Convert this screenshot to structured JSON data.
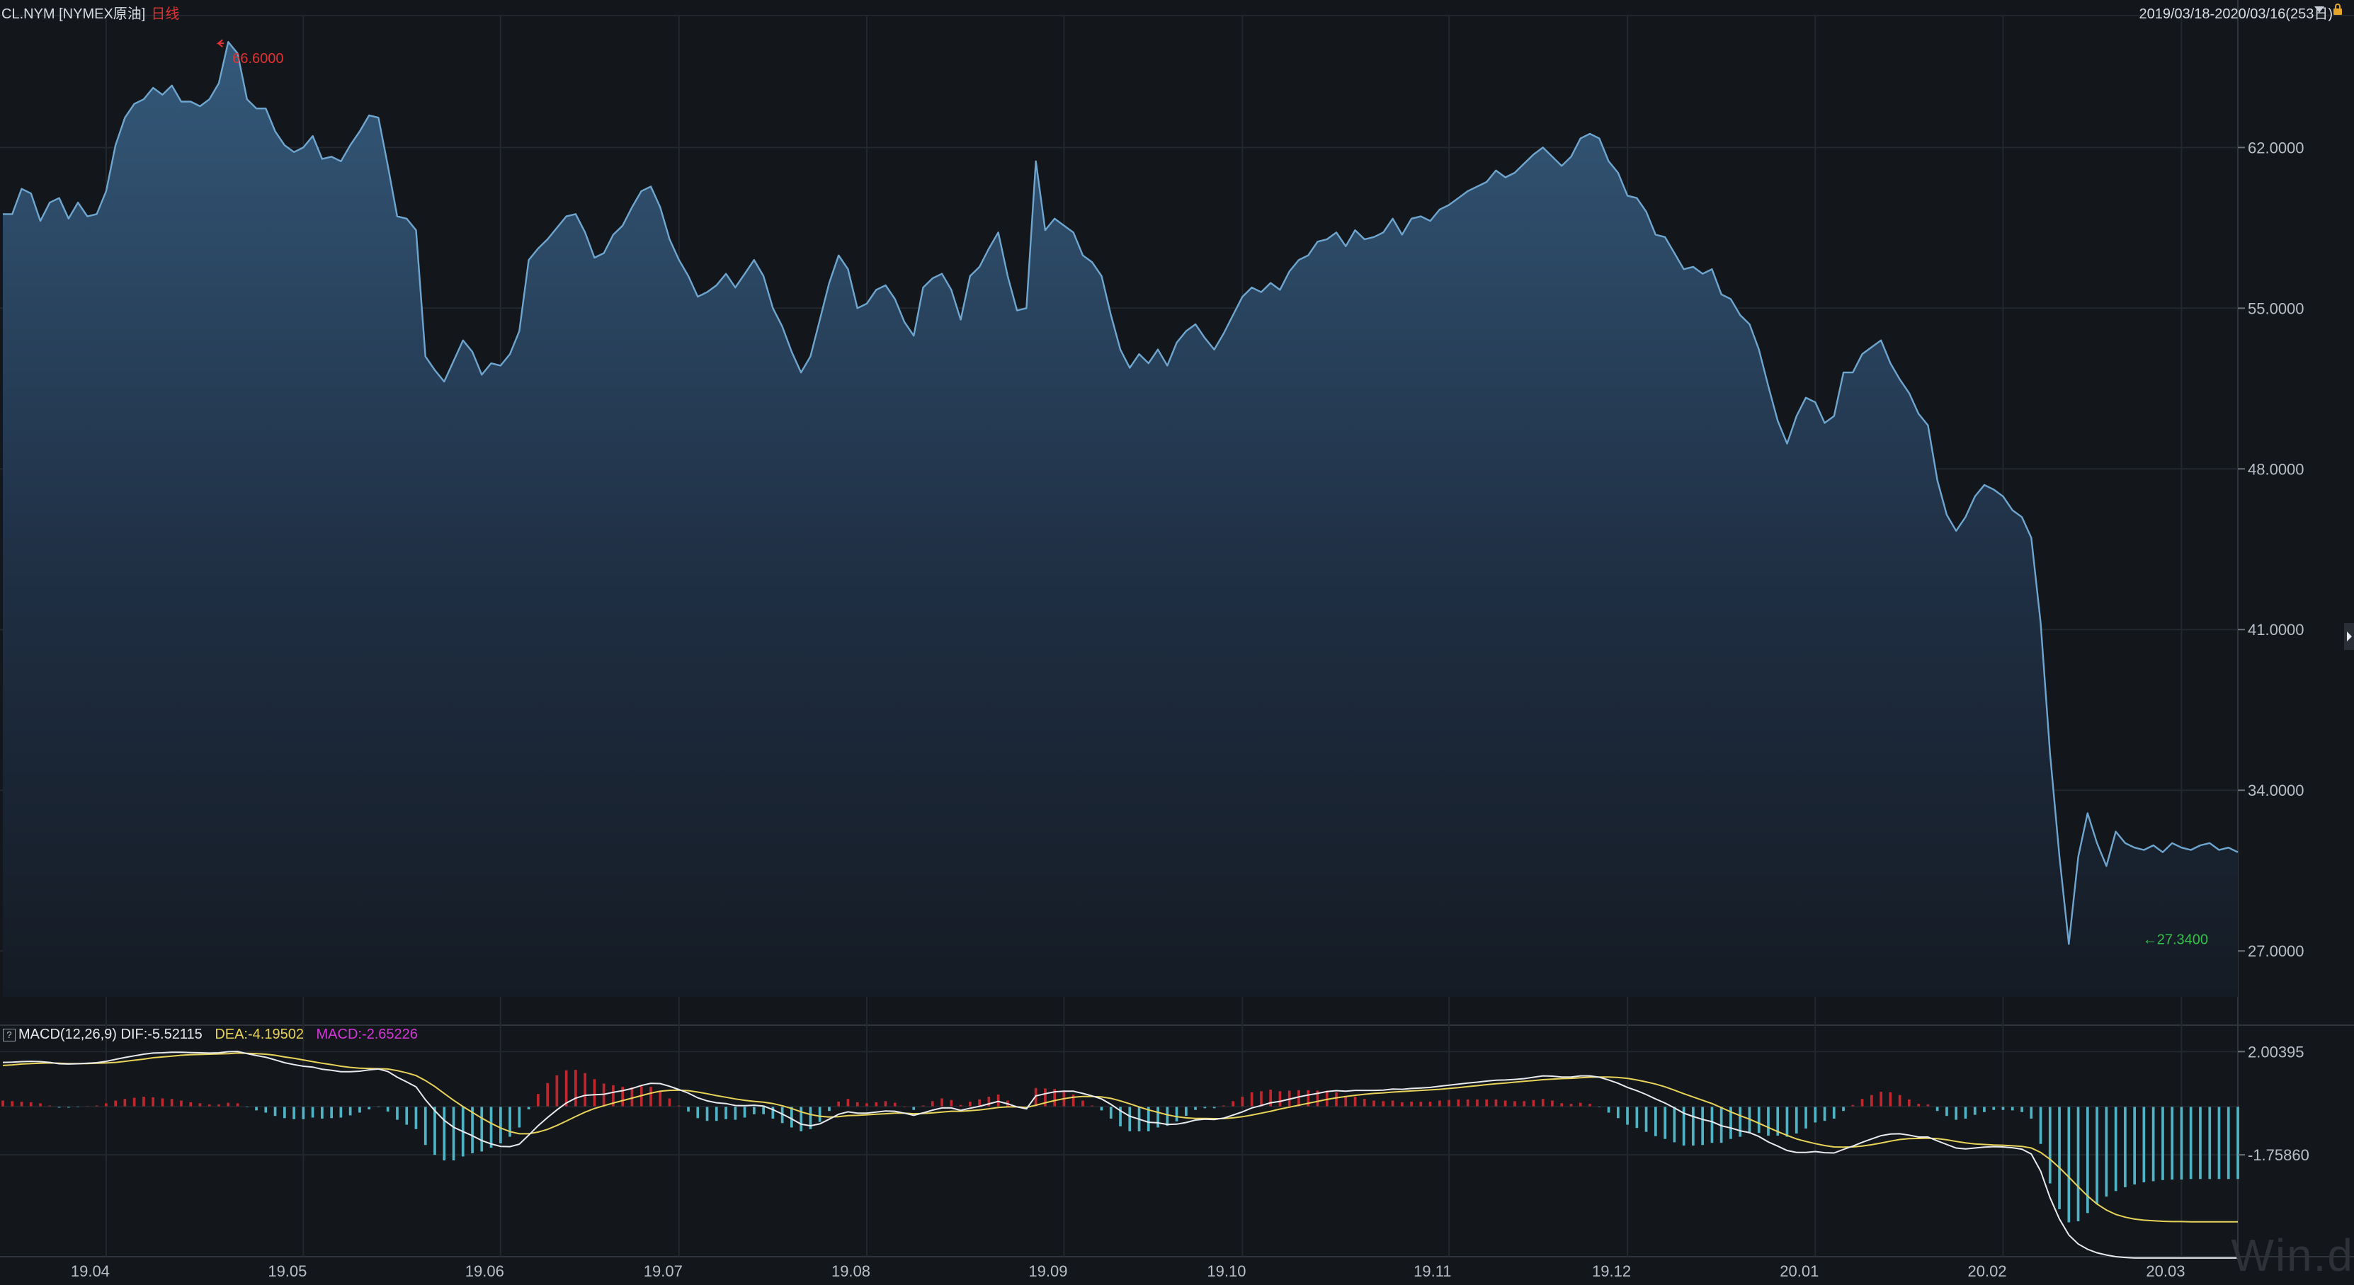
{
  "header": {
    "instrument": "CL.NYM [NYMEX原油]",
    "period": "日线",
    "range": "2019/03/18-2020/03/16(253日)"
  },
  "colors": {
    "price_line": "#6fa6cf",
    "area_top": "#2e5270",
    "grid": "#23272e",
    "dif": "#e8eaed",
    "dea": "#e8d35a",
    "macd_label": "#d338d8",
    "hist_pos": "#c0262e",
    "hist_neg": "#4fb3c6",
    "max_label": "#e03434",
    "min_label": "#35c04a"
  },
  "icons": {
    "dropdown": "triangle-down-icon",
    "lock": "lock-icon",
    "expand": "play-arrow-icon"
  },
  "macd_legend": {
    "help": "?",
    "name": "MACD(12,26,9)",
    "dif": "DIF:-5.52115",
    "dea": "DEA:-4.19502",
    "macd": "MACD:-2.65226"
  },
  "watermark": "Win.d",
  "chart_data": [
    {
      "type": "area",
      "title": "",
      "x_tick_labels": [
        "19.04",
        "19.05",
        "19.06",
        "19.07",
        "19.08",
        "19.09",
        "19.10",
        "19.11",
        "19.12",
        "20.01",
        "20.02",
        "20.03"
      ],
      "x_tick_index": [
        11,
        32,
        53,
        72,
        92,
        113,
        132,
        154,
        173,
        193,
        213,
        232
      ],
      "y_ticks": [
        27.0,
        34.0,
        41.0,
        48.0,
        55.0,
        62.0
      ],
      "y_tick_labels": [
        "27.0000",
        "34.0000",
        "41.0000",
        "48.0000",
        "55.0000",
        "62.0000"
      ],
      "ylim": [
        25.0,
        67.5
      ],
      "max_label": "66.6000",
      "min_label": "27.3400",
      "max_index": 24,
      "min_index": 240,
      "values": [
        59.1,
        59.1,
        60.2,
        60.0,
        58.8,
        59.6,
        59.8,
        58.9,
        59.6,
        59.0,
        59.1,
        60.1,
        62.1,
        63.3,
        63.9,
        64.1,
        64.6,
        64.3,
        64.7,
        64.0,
        64.0,
        63.8,
        64.1,
        64.8,
        66.6,
        66.1,
        64.1,
        63.7,
        63.7,
        62.7,
        62.1,
        61.8,
        62.0,
        62.5,
        61.5,
        61.6,
        61.4,
        62.1,
        62.7,
        63.4,
        63.3,
        61.2,
        59.0,
        58.9,
        58.4,
        52.9,
        52.3,
        51.8,
        52.7,
        53.6,
        53.1,
        52.1,
        52.6,
        52.5,
        53.0,
        54.0,
        57.1,
        57.6,
        58.0,
        58.5,
        59.0,
        59.1,
        58.3,
        57.2,
        57.4,
        58.2,
        58.6,
        59.4,
        60.1,
        60.3,
        59.4,
        58.0,
        57.1,
        56.4,
        55.5,
        55.7,
        56.0,
        56.5,
        55.9,
        56.5,
        57.1,
        56.4,
        55.0,
        54.2,
        53.1,
        52.2,
        52.9,
        54.5,
        56.1,
        57.3,
        56.7,
        55.0,
        55.2,
        55.8,
        56.0,
        55.4,
        54.4,
        53.8,
        55.9,
        56.3,
        56.5,
        55.8,
        54.5,
        56.4,
        56.8,
        57.6,
        58.3,
        56.4,
        54.9,
        55.0,
        61.4,
        58.4,
        58.9,
        58.6,
        58.3,
        57.3,
        57.0,
        56.4,
        54.7,
        53.2,
        52.4,
        53.0,
        52.6,
        53.2,
        52.5,
        53.5,
        54.0,
        54.3,
        53.7,
        53.2,
        53.9,
        54.7,
        55.5,
        55.9,
        55.7,
        56.1,
        55.8,
        56.6,
        57.1,
        57.3,
        57.9,
        58.0,
        58.3,
        57.7,
        58.4,
        58.0,
        58.1,
        58.3,
        58.9,
        58.2,
        58.9,
        59.0,
        58.8,
        59.3,
        59.5,
        59.8,
        60.1,
        60.3,
        60.5,
        61.0,
        60.7,
        60.9,
        61.3,
        61.7,
        62.0,
        61.6,
        61.2,
        61.6,
        62.4,
        62.6,
        62.4,
        61.4,
        60.9,
        59.9,
        59.8,
        59.2,
        58.2,
        58.1,
        57.4,
        56.7,
        56.8,
        56.5,
        56.7,
        55.6,
        55.4,
        54.7,
        54.3,
        53.2,
        51.6,
        50.1,
        49.1,
        50.3,
        51.1,
        50.9,
        50.0,
        50.3,
        52.2,
        52.2,
        53.0,
        53.3,
        53.6,
        52.6,
        51.9,
        51.3,
        50.4,
        49.9,
        47.5,
        46.0,
        45.3,
        45.9,
        46.8,
        47.3,
        47.1,
        46.8,
        46.2,
        45.9,
        45.0,
        41.3,
        35.6,
        31.1,
        27.3,
        31.1,
        33.0,
        31.7,
        30.7,
        32.2,
        31.7,
        31.5,
        31.4,
        31.6,
        31.3,
        31.7,
        31.5,
        31.4,
        31.6,
        31.7,
        31.4,
        31.5,
        31.3
      ]
    },
    {
      "type": "line",
      "title": "",
      "series": [
        {
          "name": "DIF",
          "values": [
            1.61,
            1.62,
            1.64,
            1.65,
            1.64,
            1.61,
            1.56,
            1.55,
            1.56,
            1.58,
            1.6,
            1.65,
            1.72,
            1.79,
            1.85,
            1.91,
            1.95,
            1.96,
            1.98,
            1.98,
            1.97,
            1.96,
            1.95,
            1.96,
            2.0,
            2.01,
            1.93,
            1.86,
            1.8,
            1.7,
            1.6,
            1.53,
            1.47,
            1.44,
            1.36,
            1.32,
            1.27,
            1.27,
            1.29,
            1.34,
            1.37,
            1.28,
            1.07,
            0.9,
            0.72,
            0.25,
            -0.15,
            -0.5,
            -0.75,
            -0.91,
            -1.06,
            -1.24,
            -1.36,
            -1.45,
            -1.46,
            -1.37,
            -1.04,
            -0.7,
            -0.4,
            -0.12,
            0.13,
            0.31,
            0.41,
            0.43,
            0.45,
            0.52,
            0.58,
            0.66,
            0.77,
            0.85,
            0.84,
            0.74,
            0.62,
            0.49,
            0.32,
            0.21,
            0.14,
            0.11,
            0.04,
            0.03,
            0.05,
            0.02,
            -0.11,
            -0.27,
            -0.45,
            -0.64,
            -0.7,
            -0.63,
            -0.46,
            -0.28,
            -0.19,
            -0.24,
            -0.24,
            -0.2,
            -0.16,
            -0.17,
            -0.24,
            -0.32,
            -0.23,
            -0.13,
            -0.05,
            -0.05,
            -0.14,
            -0.06,
            0.01,
            0.1,
            0.19,
            0.1,
            -0.01,
            -0.08,
            0.39,
            0.47,
            0.54,
            0.56,
            0.56,
            0.48,
            0.39,
            0.28,
            0.08,
            -0.15,
            -0.35,
            -0.46,
            -0.57,
            -0.59,
            -0.65,
            -0.64,
            -0.58,
            -0.49,
            -0.46,
            -0.47,
            -0.42,
            -0.31,
            -0.19,
            -0.05,
            0.04,
            0.14,
            0.19,
            0.27,
            0.35,
            0.42,
            0.48,
            0.55,
            0.58,
            0.56,
            0.59,
            0.59,
            0.59,
            0.6,
            0.64,
            0.63,
            0.66,
            0.68,
            0.7,
            0.74,
            0.78,
            0.82,
            0.86,
            0.89,
            0.93,
            0.96,
            0.97,
            0.99,
            1.02,
            1.07,
            1.12,
            1.11,
            1.08,
            1.08,
            1.12,
            1.12,
            1.07,
            0.97,
            0.85,
            0.7,
            0.58,
            0.44,
            0.28,
            0.13,
            -0.05,
            -0.24,
            -0.36,
            -0.47,
            -0.55,
            -0.7,
            -0.78,
            -0.88,
            -0.95,
            -1.09,
            -1.29,
            -1.44,
            -1.6,
            -1.67,
            -1.67,
            -1.64,
            -1.68,
            -1.69,
            -1.56,
            -1.44,
            -1.3,
            -1.18,
            -1.06,
            -1.0,
            -0.99,
            -1.04,
            -1.11,
            -1.11,
            -1.25,
            -1.38,
            -1.51,
            -1.54,
            -1.51,
            -1.48,
            -1.46,
            -1.47,
            -1.5,
            -1.55,
            -1.73,
            -2.35,
            -3.32,
            -4.1,
            -4.68,
            -5.01,
            -5.2,
            -5.33,
            -5.41,
            -5.47,
            -5.5,
            -5.52,
            -5.52,
            -5.52,
            -5.52,
            -5.52,
            -5.52,
            -5.52,
            -5.52,
            -5.52,
            -5.52,
            -5.52,
            -5.52
          ]
        },
        {
          "name": "DEA",
          "values": [
            1.5,
            1.52,
            1.55,
            1.57,
            1.58,
            1.59,
            1.58,
            1.57,
            1.57,
            1.57,
            1.58,
            1.59,
            1.61,
            1.65,
            1.69,
            1.73,
            1.78,
            1.81,
            1.84,
            1.87,
            1.89,
            1.9,
            1.91,
            1.92,
            1.93,
            1.95,
            1.94,
            1.93,
            1.91,
            1.87,
            1.81,
            1.76,
            1.7,
            1.64,
            1.58,
            1.53,
            1.47,
            1.43,
            1.4,
            1.39,
            1.38,
            1.37,
            1.31,
            1.23,
            1.13,
            0.95,
            0.73,
            0.48,
            0.23,
            0.0,
            -0.21,
            -0.42,
            -0.61,
            -0.78,
            -0.91,
            -0.99,
            -0.99,
            -0.93,
            -0.83,
            -0.69,
            -0.53,
            -0.36,
            -0.2,
            -0.07,
            0.03,
            0.13,
            0.22,
            0.31,
            0.4,
            0.49,
            0.56,
            0.59,
            0.6,
            0.58,
            0.53,
            0.47,
            0.4,
            0.34,
            0.28,
            0.23,
            0.19,
            0.16,
            0.11,
            0.03,
            -0.07,
            -0.19,
            -0.29,
            -0.35,
            -0.38,
            -0.37,
            -0.33,
            -0.32,
            -0.3,
            -0.28,
            -0.26,
            -0.24,
            -0.24,
            -0.26,
            -0.25,
            -0.23,
            -0.2,
            -0.17,
            -0.17,
            -0.15,
            -0.12,
            -0.08,
            -0.03,
            -0.01,
            -0.01,
            -0.03,
            0.05,
            0.14,
            0.22,
            0.29,
            0.34,
            0.37,
            0.37,
            0.35,
            0.3,
            0.21,
            0.1,
            -0.01,
            -0.12,
            -0.21,
            -0.3,
            -0.37,
            -0.41,
            -0.43,
            -0.43,
            -0.44,
            -0.44,
            -0.41,
            -0.37,
            -0.31,
            -0.24,
            -0.17,
            -0.09,
            -0.02,
            0.05,
            0.12,
            0.19,
            0.26,
            0.32,
            0.37,
            0.41,
            0.45,
            0.48,
            0.5,
            0.53,
            0.55,
            0.57,
            0.59,
            0.61,
            0.63,
            0.66,
            0.69,
            0.73,
            0.76,
            0.8,
            0.83,
            0.86,
            0.89,
            0.92,
            0.95,
            0.98,
            1.0,
            1.02,
            1.03,
            1.05,
            1.07,
            1.08,
            1.08,
            1.06,
            1.03,
            0.97,
            0.9,
            0.82,
            0.72,
            0.6,
            0.47,
            0.35,
            0.23,
            0.11,
            -0.04,
            -0.19,
            -0.33,
            -0.46,
            -0.61,
            -0.76,
            -0.91,
            -1.05,
            -1.18,
            -1.27,
            -1.35,
            -1.42,
            -1.47,
            -1.48,
            -1.47,
            -1.44,
            -1.39,
            -1.33,
            -1.26,
            -1.2,
            -1.17,
            -1.16,
            -1.15,
            -1.17,
            -1.21,
            -1.27,
            -1.32,
            -1.36,
            -1.38,
            -1.4,
            -1.41,
            -1.43,
            -1.45,
            -1.51,
            -1.67,
            -1.92,
            -2.23,
            -2.57,
            -2.92,
            -3.26,
            -3.55,
            -3.77,
            -3.93,
            -4.03,
            -4.1,
            -4.14,
            -4.16,
            -4.18,
            -4.19,
            -4.19,
            -4.2,
            -4.2,
            -4.2,
            -4.2,
            -4.2,
            -4.2
          ]
        }
      ],
      "hist_values_from": "2*(DIF-DEA)",
      "y_ticks": [
        2.00395,
        -1.7586
      ],
      "y_tick_labels": [
        "2.00395",
        "-1.75860"
      ],
      "ylim": [
        -5.6,
        2.4
      ]
    }
  ]
}
